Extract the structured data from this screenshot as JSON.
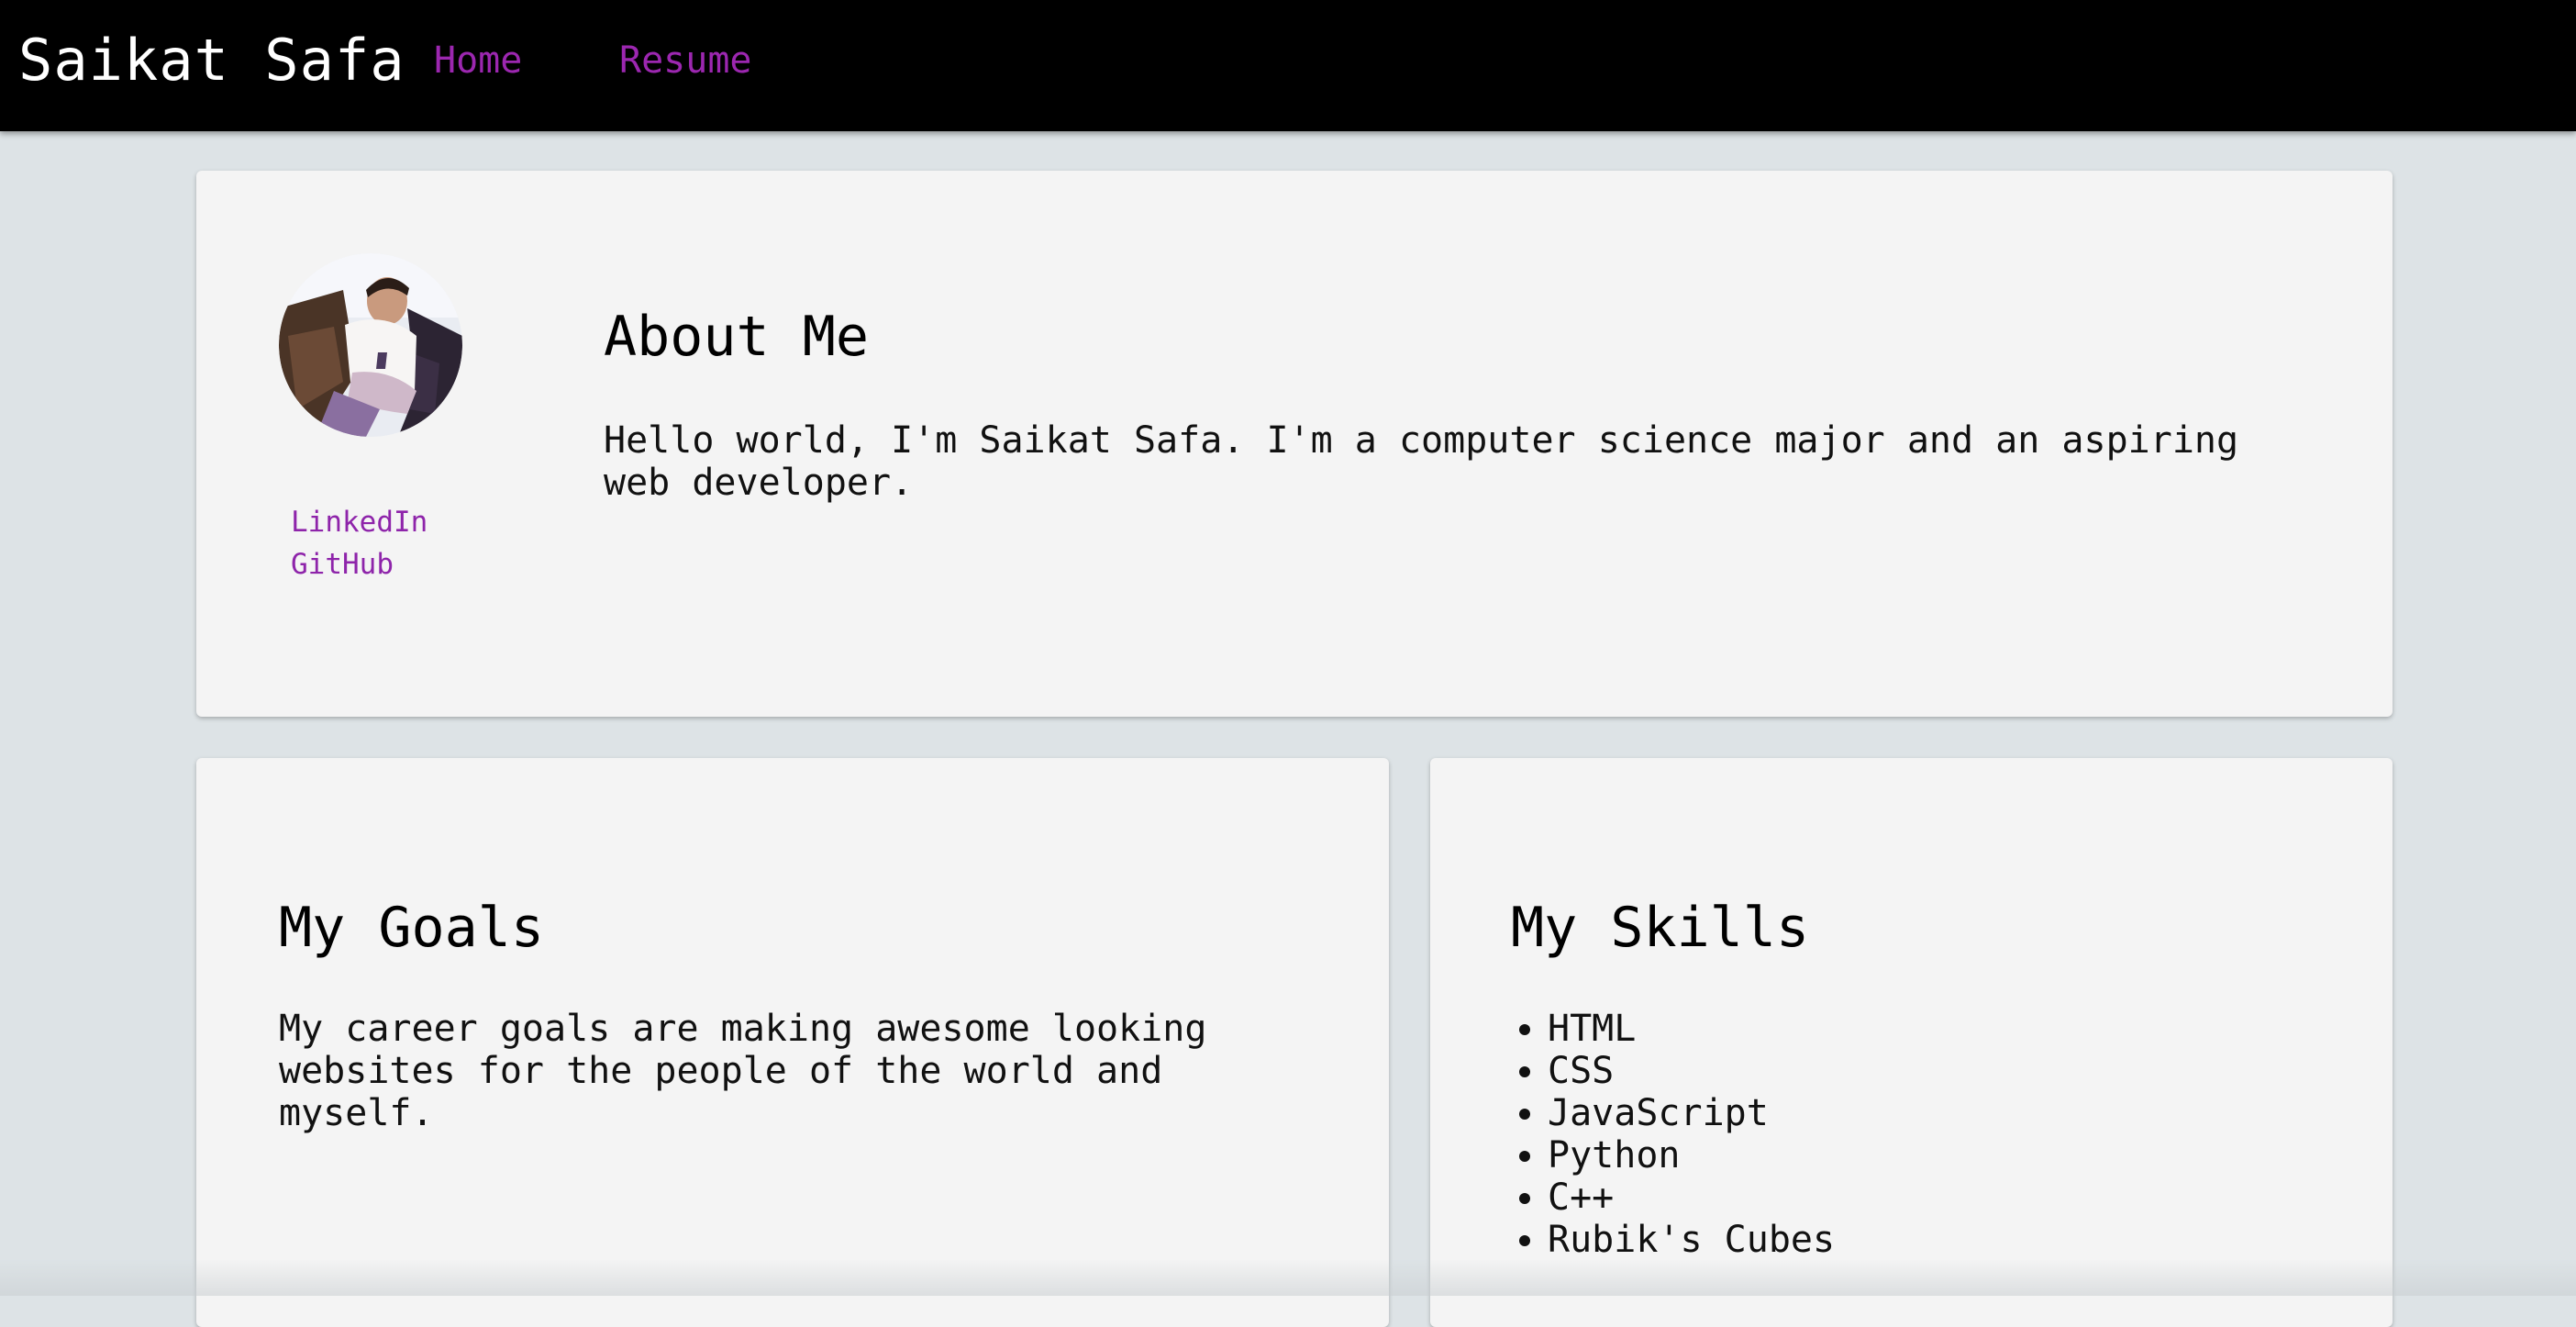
{
  "navbar": {
    "brand": "Saikat Safa",
    "links": [
      {
        "label": "Home"
      },
      {
        "label": "Resume"
      }
    ],
    "background": "#000000",
    "link_color": "#9c27b0"
  },
  "about": {
    "avatar_icon": "profile-photo",
    "social": [
      {
        "label": "LinkedIn"
      },
      {
        "label": "GitHub"
      }
    ],
    "title": "About Me",
    "text": "Hello world, I'm Saikat Safa. I'm a computer science major and an aspiring web developer."
  },
  "goals": {
    "title": "My Goals",
    "text": "My career goals are making awesome looking websites for the people of the world and myself."
  },
  "skills": {
    "title": "My Skills",
    "items": [
      "HTML",
      "CSS",
      "JavaScript",
      "Python",
      "C++",
      "Rubik's Cubes"
    ]
  },
  "colors": {
    "page_background": "#dde3e6",
    "card_background": "#f4f4f4",
    "social_link": "#8e24aa"
  }
}
